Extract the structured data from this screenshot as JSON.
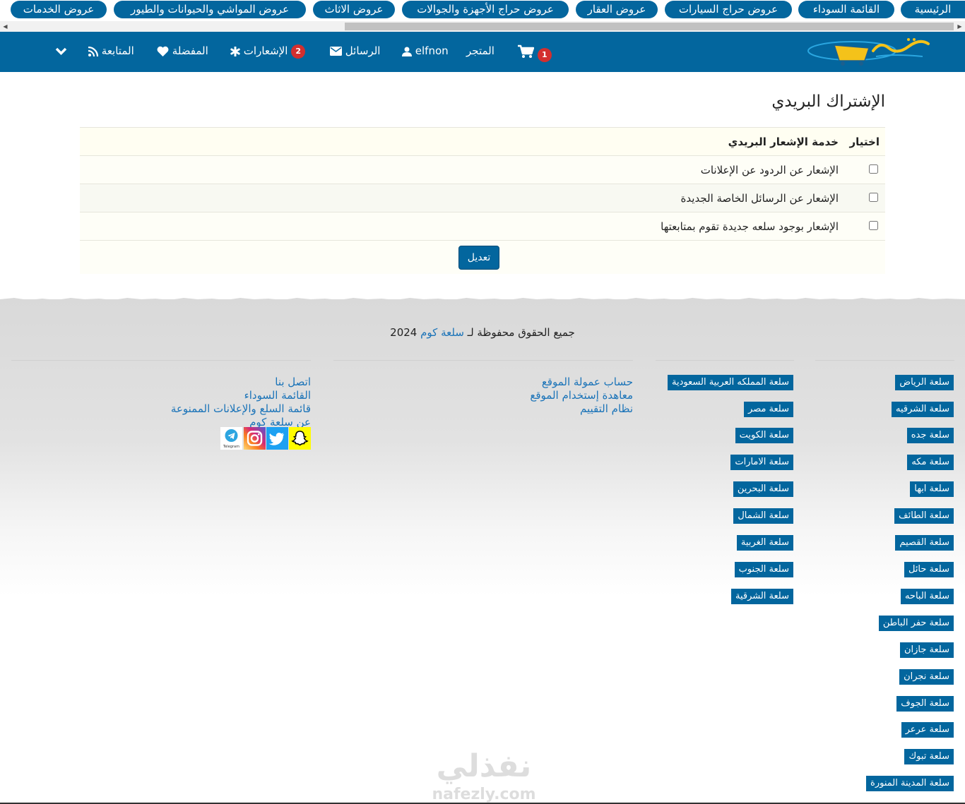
{
  "categories": [
    {
      "label": "الرئيسية"
    },
    {
      "label": "القائمة السوداء"
    },
    {
      "label": "عروض حراج السيارات"
    },
    {
      "label": "عروض العقار"
    },
    {
      "label": "عروض حراج الأجهزة والجوالات"
    },
    {
      "label": "عروض الاثاث"
    },
    {
      "label": "عروض المواشي والحيوانات والطيور"
    },
    {
      "label": "عروض الخدمات"
    }
  ],
  "nav": {
    "cart_count": "1",
    "store": "المتجر",
    "username": "elfnon",
    "messages": "الرسائل",
    "notifications": "الإشعارات",
    "notifications_count": "2",
    "favorites": "المفضلة",
    "following": "المتابعة"
  },
  "colors": {
    "primary": "#03669e",
    "badge": "#d32f2f",
    "link": "#1a73b8"
  },
  "page_title": "الإشتراك البريدي",
  "table": {
    "headers": {
      "choose": "اختيار",
      "service": "خدمة الإشعار البريدي"
    },
    "rows": [
      {
        "label": "الإشعار عن الردود عن الإعلانات",
        "checked": false
      },
      {
        "label": "الإشعار عن الرسائل الخاصة الجديدة",
        "checked": false
      },
      {
        "label": "الإشعار بوجود سلعه جديدة تقوم بمتابعتها",
        "checked": false
      }
    ],
    "submit_label": "تعديل"
  },
  "footer": {
    "copyright_prefix": "جميع الحقوق محفوظة لـ",
    "copyright_site": "سلعة كوم",
    "copyright_year": "2024",
    "cities_col1": [
      "سلعة الرياض",
      "سلعة الشرقيه",
      "سلعة جده",
      "سلعة مكه",
      "سلعة ابها",
      "سلعة الطائف",
      "سلعة القصيم",
      "سلعة حائل",
      "سلعة الباحه",
      "سلعة حفر الباطن",
      "سلعة جازان",
      "سلعة نجران",
      "سلعة الجوف",
      "سلعة عرعر",
      "سلعة تبوك",
      "سلعة المدينة المنورة"
    ],
    "cities_col2": [
      "سلعة المملكه العربية السعودية",
      "سلعة مصر",
      "سلعة الكويت",
      "سلعة الامارات",
      "سلعة البحرين",
      "سلعة الشمال",
      "سلعة الغربية",
      "سلعة الجنوب",
      "سلعة الشرقية"
    ],
    "links_col3": [
      "حساب عمولة الموقع",
      "معاهدة إستخدام الموقع",
      "نظام التقييم"
    ],
    "links_col4": [
      "اتصل بنا",
      "القائمة السوداء",
      "قائمة السلع والإعلانات الممنوعة",
      "عن سلعة كوم"
    ],
    "social": [
      {
        "icon": "snapchat-icon"
      },
      {
        "icon": "twitter-icon"
      },
      {
        "icon": "instagram-icon"
      },
      {
        "icon": "telegram-icon",
        "caption": "Telegram"
      }
    ]
  },
  "watermark": {
    "arabic": "نفذلي",
    "latin": "nafezly.com"
  }
}
